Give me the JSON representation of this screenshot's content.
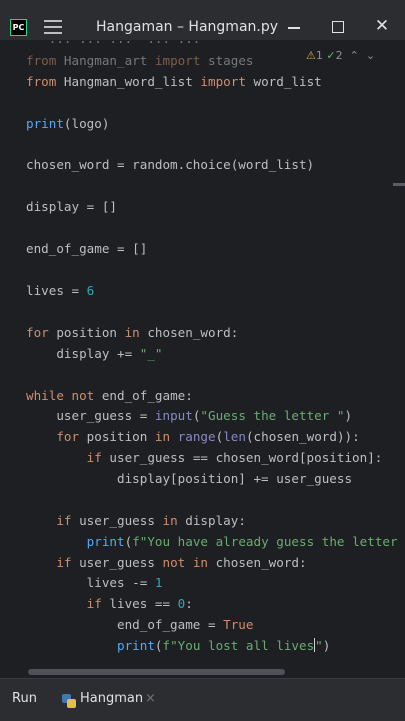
{
  "window": {
    "app_logo": "PC",
    "title": "Hangaman – Hangman.py"
  },
  "icons": {
    "app": "pycharm-logo",
    "menu": "hamburger-menu-icon",
    "minimize": "minimize-icon",
    "maximize": "maximize-icon",
    "close": "close-icon"
  },
  "inspections": {
    "warning_symbol": "⚠",
    "warnings": "1",
    "check_symbol": "✓",
    "weak": "2",
    "up": "⌃",
    "down": "⌄"
  },
  "code": {
    "l0": {
      "partial": "   ... ... ...  ... ..."
    },
    "l1": {
      "kw1": "from",
      "mod": " Hangman_art ",
      "kw2": "import",
      "name": " stages"
    },
    "l2": {
      "kw1": "from",
      "mod": " Hangman_word_list ",
      "kw2": "import",
      "name": " word_list"
    },
    "l3": {
      "fn": "print",
      "rest": "(logo)"
    },
    "l4": {
      "text": "chosen_word = random.choice(word_list)"
    },
    "l5": {
      "text": "display = []"
    },
    "l6": {
      "text": "end_of_game = []"
    },
    "l7": {
      "pre": "lives = ",
      "num": "6"
    },
    "l8": {
      "kw1": "for",
      "mid": " position ",
      "kw2": "in",
      "post": " chosen_word:"
    },
    "l9": {
      "pre": "    display += ",
      "str": "\"_\""
    },
    "l10": {
      "kw": "while not",
      "post": " end_of_game:"
    },
    "l11": {
      "pre": "    user_guess = ",
      "bi": "input",
      "open": "(",
      "str": "\"Guess the letter \"",
      "close": ")"
    },
    "l12": {
      "indent": "    ",
      "kw1": "for",
      "mid": " position ",
      "kw2": "in",
      "sp": " ",
      "bi1": "range",
      "p1": "(",
      "bi2": "len",
      "post": "(chosen_word)):"
    },
    "l13": {
      "indent": "        ",
      "kw": "if",
      "post": " user_guess == chosen_word[position]:"
    },
    "l14": {
      "text": "            display[position] += user_guess"
    },
    "l15": {
      "indent": "    ",
      "kw1": "if",
      "mid": " user_guess ",
      "kw2": "in",
      "post": " display:"
    },
    "l16": {
      "indent": "        ",
      "fn": "print",
      "open": "(",
      "str": "f\"You have already guess the letter"
    },
    "l17": {
      "indent": "    ",
      "kw1": "if",
      "mid": " user_guess ",
      "kw2": "not in",
      "post": " chosen_word:"
    },
    "l18": {
      "pre": "        lives -= ",
      "num": "1"
    },
    "l19": {
      "indent": "        ",
      "kw": "if",
      "mid": " lives == ",
      "num": "0",
      "post": ":"
    },
    "l20": {
      "pre": "            end_of_game = ",
      "kw": "True"
    },
    "l21": {
      "indent": "            ",
      "fn": "print",
      "open": "(",
      "str1": "f\"You lost all lives",
      "str2": "\"",
      "close": ")"
    }
  },
  "bottom": {
    "run_label": "Run",
    "config_label": "Hangman",
    "close_glyph": "×"
  },
  "colors": {
    "background": "#1e1f22",
    "keyword": "#cf8e6d",
    "function": "#56a8f5",
    "builtin": "#8888c6",
    "string": "#6aab73",
    "number": "#2aacb8",
    "text": "#bcbec4"
  }
}
